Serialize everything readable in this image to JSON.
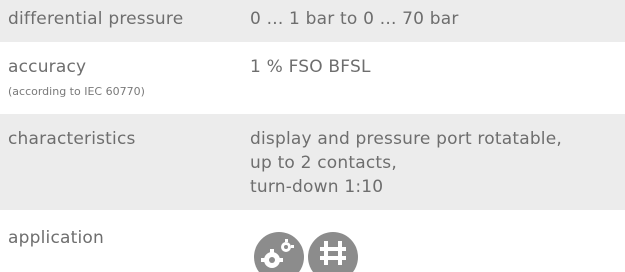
{
  "specs": [
    {
      "label": "differential pressure",
      "value": "0 ... 1 bar to 0 ... 70 bar"
    },
    {
      "label": "accuracy",
      "note": "(according to  IEC 60770)",
      "value": "1 % FSO BFSL"
    },
    {
      "label": "characteristics",
      "value_lines": [
        "display and pressure port rotatable,",
        "up to 2 contacts,",
        "turn-down 1:10"
      ]
    },
    {
      "label": "application",
      "icons": [
        "industrial-gears-icon",
        "plant-engineering-icon"
      ]
    }
  ],
  "colors": {
    "row_shade": "#ececec",
    "text": "#6e6e6e",
    "icon_fill": "#8c8c8c"
  }
}
